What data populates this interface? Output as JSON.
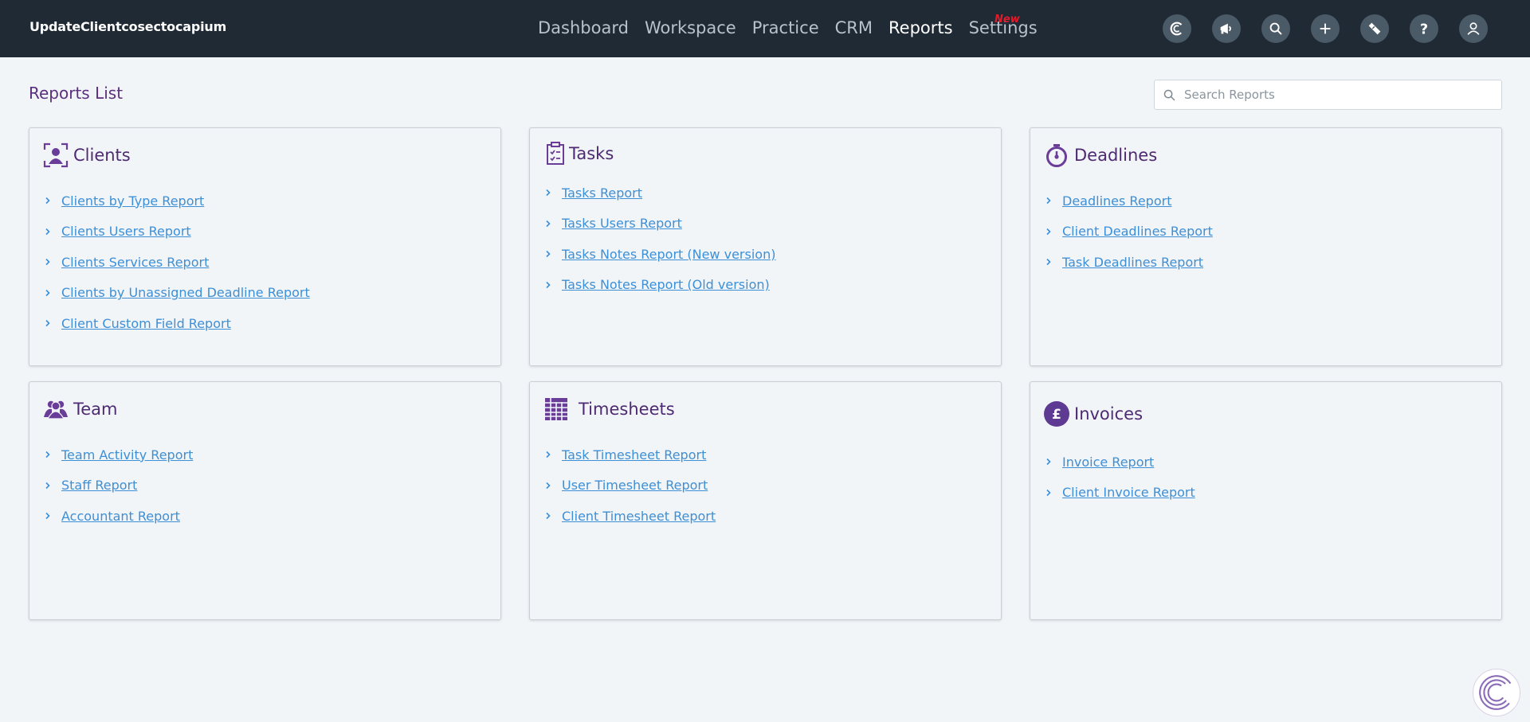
{
  "brand": "UpdateClientcosectocapium",
  "nav": {
    "items": [
      {
        "label": "Dashboard"
      },
      {
        "label": "Workspace"
      },
      {
        "label": "Practice"
      },
      {
        "label": "CRM"
      },
      {
        "label": "Reports"
      },
      {
        "label": "Settings"
      }
    ],
    "active": "Reports",
    "badge": "New"
  },
  "header_icons": [
    "capium-logo-icon",
    "megaphone-icon",
    "search-icon",
    "plus-icon",
    "ticket-icon",
    "help-icon",
    "user-icon"
  ],
  "page": {
    "title": "Reports List",
    "search_placeholder": "Search Reports"
  },
  "sections": [
    {
      "title": "Clients",
      "icon": "client-icon",
      "links": [
        "Clients by Type Report",
        "Clients Users Report",
        "Clients Services Report",
        "Clients by Unassigned Deadline Report",
        "Client Custom Field Report"
      ]
    },
    {
      "title": "Tasks",
      "icon": "clipboard-icon",
      "links": [
        "Tasks Report",
        "Tasks Users Report",
        "Tasks Notes Report (New version)",
        "Tasks Notes Report (Old version)"
      ]
    },
    {
      "title": "Deadlines",
      "icon": "stopwatch-icon",
      "links": [
        "Deadlines Report",
        "Client Deadlines Report",
        "Task Deadlines Report"
      ]
    },
    {
      "title": "Team",
      "icon": "team-icon",
      "links": [
        "Team Activity Report",
        "Staff Report",
        "Accountant Report"
      ]
    },
    {
      "title": "Timesheets",
      "icon": "grid-table-icon",
      "links": [
        "Task Timesheet Report",
        "User Timesheet Report",
        "Client Timesheet Report"
      ]
    },
    {
      "title": "Invoices",
      "icon": "pound-icon",
      "links": [
        "Invoice Report",
        "Client Invoice Report"
      ]
    }
  ],
  "colors": {
    "topbar": "#1f2a35",
    "accent": "#5a2f7d",
    "link": "#3d8fd6",
    "badge": "#e21b2b",
    "background": "#f2f5f8"
  }
}
